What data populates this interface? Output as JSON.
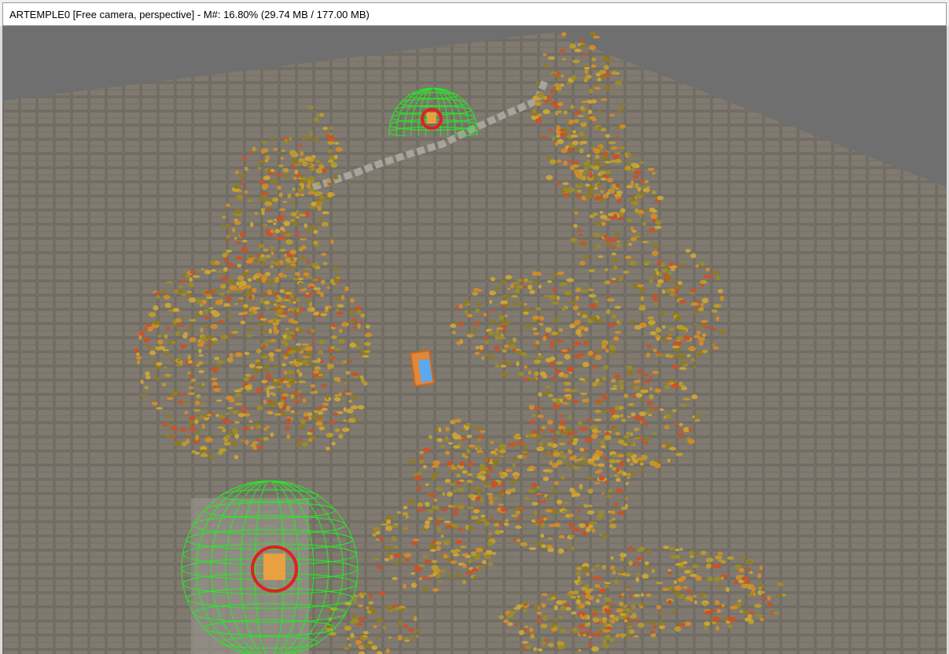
{
  "window": {
    "title": "ARTEMPLE0 [Free camera, perspective] - M#: 16.80% (29.74 MB / 177.00 MB)"
  },
  "scene": {
    "background_color": "#6f6f6f",
    "ground_color": "#7a756c",
    "tree_colors": [
      "#b89a2e",
      "#c9a336",
      "#9a8a2a",
      "#d08a2a",
      "#c8532a",
      "#8f7a24"
    ],
    "gizmo_color": "#22ee22",
    "light_marker_color": "#e02020",
    "camera_marker_color": "#4a9be0"
  }
}
